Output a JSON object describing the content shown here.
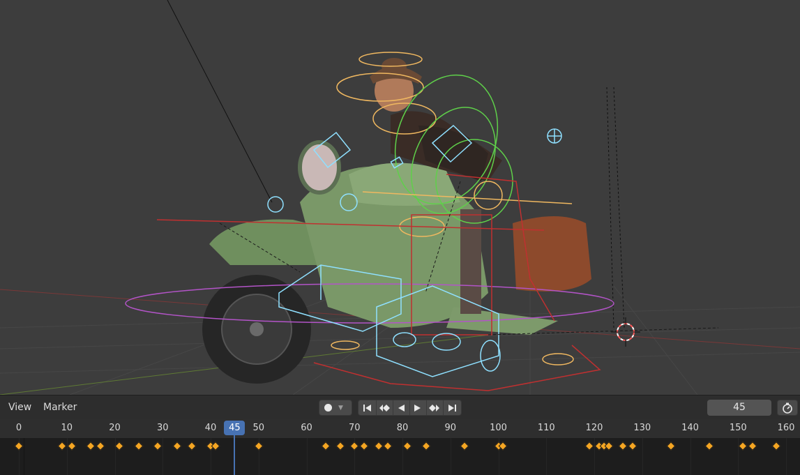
{
  "timeline": {
    "menu": {
      "view": "View",
      "marker": "Marker"
    },
    "current_frame": "45",
    "ticks": [
      "0",
      "10",
      "20",
      "30",
      "40",
      "50",
      "60",
      "70",
      "80",
      "90",
      "100",
      "110",
      "120",
      "130",
      "140",
      "150",
      "160"
    ],
    "keyframes": [
      0,
      9,
      11,
      15,
      17,
      21,
      25,
      29,
      33,
      36,
      40,
      41,
      50,
      64,
      67,
      70,
      72,
      75,
      77,
      81,
      85,
      93,
      100,
      101,
      119,
      121,
      122,
      123,
      126,
      128,
      136,
      144,
      151,
      153,
      158
    ]
  },
  "icons": {
    "record": "record-icon",
    "record_menu": "chevron-down-icon",
    "jump_start": "jump-to-start-icon",
    "prev_keyframe": "previous-keyframe-icon",
    "play_reverse": "play-reverse-icon",
    "play": "play-icon",
    "next_keyframe": "next-keyframe-icon",
    "jump_end": "jump-to-end-icon",
    "timer": "stopwatch-icon"
  },
  "colors": {
    "playhead": "#4772b3",
    "keyframe": "#f5a623",
    "viewport_bg": "#3d3d3d"
  }
}
